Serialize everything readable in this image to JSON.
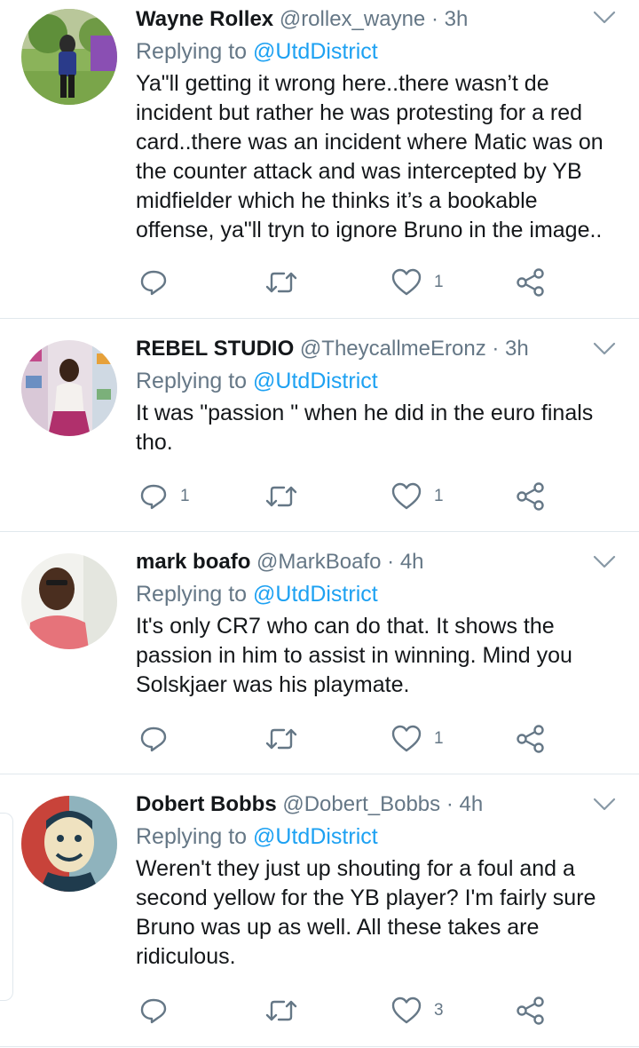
{
  "tweets": [
    {
      "name": "Wayne Rollex",
      "handle": "@rollex_wayne",
      "dot": "·",
      "time": "3h",
      "replying_prefix": "Replying to",
      "replying_to": "@UtdDistrict",
      "lines": [
        "Ya\"ll getting it wrong here..there wasn’t de",
        "incident but rather he was protesting for a red",
        "card..there was an incident where Matic was on",
        "the counter attack and was intercepted by YB",
        "midfielder which he thinks it’s a bookable",
        "offense, ya\"ll tryn to ignore Bruno in the image.."
      ],
      "reply_count": "",
      "retweet_count": "",
      "like_count": "1"
    },
    {
      "name": "REBEL STUDIO",
      "handle": "@TheycallmeEronz",
      "dot": "·",
      "time": "3h",
      "replying_prefix": "Replying to",
      "replying_to": "@UtdDistrict",
      "lines": [
        "It was \"passion \" when he did in the euro finals",
        "tho."
      ],
      "reply_count": "1",
      "retweet_count": "",
      "like_count": "1"
    },
    {
      "name": "mark boafo",
      "handle": "@MarkBoafo",
      "dot": "·",
      "time": "4h",
      "replying_prefix": "Replying to",
      "replying_to": "@UtdDistrict",
      "lines": [
        "It's only CR7 who can do that.  It shows the",
        "passion in him to assist in winning. Mind you",
        "Solskjaer was his playmate."
      ],
      "reply_count": "",
      "retweet_count": "",
      "like_count": "1"
    },
    {
      "name": "Dobert Bobbs",
      "handle": "@Dobert_Bobbs",
      "dot": "·",
      "time": "4h",
      "replying_prefix": "Replying to",
      "replying_to": "@UtdDistrict",
      "lines": [
        "Weren't they just up shouting for a foul and a",
        "second yellow for the YB player? I'm fairly sure",
        "Bruno was up as well. All these takes are",
        "ridiculous."
      ],
      "reply_count": "",
      "retweet_count": "",
      "like_count": "3"
    }
  ],
  "icons": {
    "reply": "reply-icon",
    "retweet": "retweet-icon",
    "like": "heart-icon",
    "share": "share-icon",
    "menu": "chevron-down-icon"
  },
  "colors": {
    "link": "#1da1f2",
    "secondary": "#657786",
    "text": "#14171a",
    "divider": "#e1e8ed"
  }
}
